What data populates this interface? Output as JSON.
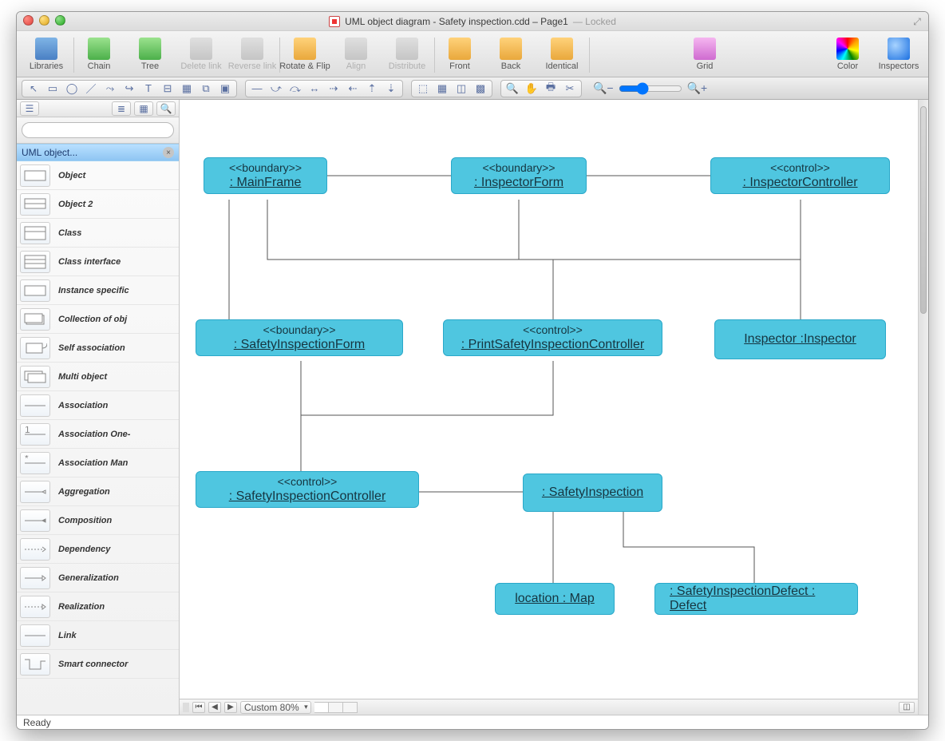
{
  "window": {
    "title_main": "UML object diagram - Safety inspection.cdd – Page1",
    "title_sub": "— Locked"
  },
  "toolbar": {
    "libraries": "Libraries",
    "chain": "Chain",
    "tree": "Tree",
    "delete_link": "Delete link",
    "reverse_link": "Reverse link",
    "rotate_flip": "Rotate & Flip",
    "align": "Align",
    "distribute": "Distribute",
    "front": "Front",
    "back": "Back",
    "identical": "Identical",
    "grid": "Grid",
    "color": "Color",
    "inspectors": "Inspectors"
  },
  "sidebar": {
    "library_label": "UML object...",
    "search_placeholder": "",
    "items": [
      {
        "label": "Object"
      },
      {
        "label": "Object 2"
      },
      {
        "label": "Class"
      },
      {
        "label": "Class interface"
      },
      {
        "label": "Instance specific"
      },
      {
        "label": "Collection of obj"
      },
      {
        "label": "Self association"
      },
      {
        "label": "Multi object"
      },
      {
        "label": "Association"
      },
      {
        "label": "Association One-"
      },
      {
        "label": "Association Man"
      },
      {
        "label": "Aggregation"
      },
      {
        "label": "Composition"
      },
      {
        "label": "Dependency"
      },
      {
        "label": "Generalization"
      },
      {
        "label": "Realization"
      },
      {
        "label": "Link"
      },
      {
        "label": "Smart connector"
      }
    ]
  },
  "canvas": {
    "zoom_label": "Custom 80%",
    "nodes": {
      "mainframe": {
        "stereo": "<<boundary>>",
        "name": ": MainFrame"
      },
      "inspform": {
        "stereo": "<<boundary>>",
        "name": ": InspectorForm"
      },
      "inspctrl": {
        "stereo": "<<control>>",
        "name": ": InspectorController"
      },
      "sform": {
        "stereo": "<<boundary>>",
        "name": ": SafetyInspectionForm"
      },
      "printctrl": {
        "stereo": "<<control>>",
        "name": ": PrintSafetyInspectionController"
      },
      "inspector": {
        "stereo": "",
        "name": "Inspector :Inspector"
      },
      "sctrl": {
        "stereo": "<<control>>",
        "name": ": SafetyInspectionController"
      },
      "sinsp": {
        "stereo": "",
        "name": ": SafetyInspection"
      },
      "location": {
        "stereo": "",
        "name": "location : Map"
      },
      "defect": {
        "stereo": "",
        "name": ": SafetyInspectionDefect : Defect"
      }
    }
  },
  "status": {
    "text": "Ready"
  }
}
